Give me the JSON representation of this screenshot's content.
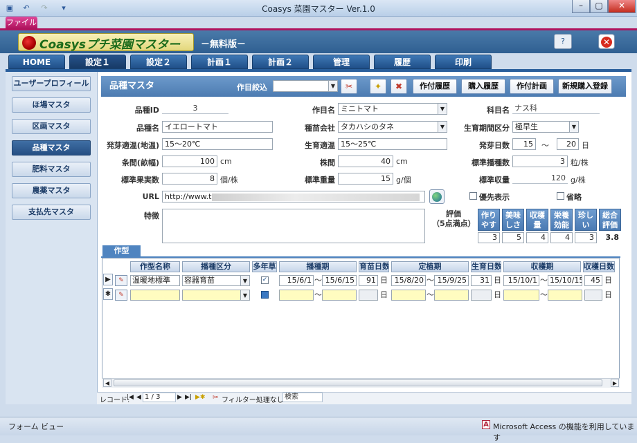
{
  "window": {
    "title": "Coasys 菜園マスター Ver.1.0",
    "file_tab": "ファイル"
  },
  "app": {
    "logo": "Coasysプチ菜園マスター",
    "edition": "－無料版－"
  },
  "nav_tabs": [
    "HOME",
    "設定１",
    "設定２",
    "計画１",
    "計画２",
    "管理",
    "履歴",
    "印刷"
  ],
  "sidebar": [
    "ユーザープロフィール",
    "ほ場マスタ",
    "区画マスタ",
    "品種マスタ",
    "肥料マスタ",
    "農薬マスタ",
    "支払先マスタ"
  ],
  "form": {
    "title": "品種マスタ",
    "filter_label": "作目絞込",
    "buttons": [
      "作付履歴",
      "購入履歴",
      "作付計画",
      "新規購入登録"
    ]
  },
  "fields": {
    "hinshu_id": {
      "label": "品種ID",
      "value": "3"
    },
    "sakumoku": {
      "label": "作目名",
      "value": "ミニトマト"
    },
    "kamoku": {
      "label": "科目名",
      "value": "ナス科"
    },
    "hinshu_name": {
      "label": "品種名",
      "value": "イエロートマト"
    },
    "company": {
      "label": "種苗会社",
      "value": "タカハシのタネ"
    },
    "period": {
      "label": "生育期間区分",
      "value": "極早生"
    },
    "hatsuga_temp": {
      "label": "発芽適温(地温)",
      "value": "15～20℃"
    },
    "seiiku_temp": {
      "label": "生育適温",
      "value": "15～25℃"
    },
    "hatsuga_days": {
      "label": "発芽日数",
      "from": "15",
      "tilde": "～",
      "to": "20",
      "unit": "日"
    },
    "jokan": {
      "label": "条間(畝幅)",
      "value": "100",
      "unit": "cm"
    },
    "kabuma": {
      "label": "株間",
      "value": "40",
      "unit": "cm"
    },
    "hashu": {
      "label": "標準播種数",
      "value": "3",
      "unit": "粒/株"
    },
    "kajitsu": {
      "label": "標準果実数",
      "value": "8",
      "unit": "個/株"
    },
    "juryo": {
      "label": "標準重量",
      "value": "15",
      "unit": "g/個"
    },
    "shukaku": {
      "label": "標準収量",
      "value": "120",
      "unit": "g/株"
    },
    "url": {
      "label": "URL",
      "value": "http://www.t"
    },
    "priority": {
      "label": "優先表示"
    },
    "omit": {
      "label": "省略"
    },
    "tokucho": {
      "label": "特徴"
    }
  },
  "evaluation": {
    "label": "評価\n（5点満点）",
    "headers": [
      "作りやすさ",
      "美味しさ",
      "収穫量",
      "栄養効能",
      "珍しい",
      "総合評価"
    ],
    "values": [
      "3",
      "5",
      "4",
      "4",
      "3",
      "3.8"
    ]
  },
  "subform": {
    "tab": "作型",
    "columns": [
      "作型名称",
      "播種区分",
      "多年草",
      "播種期",
      "育苗日数",
      "定植期",
      "生育日数",
      "収穫期",
      "収穫日数"
    ],
    "rows": [
      {
        "name": "温暖地標準",
        "type": "容器育苗",
        "sow_from": "15/6/1",
        "sow_to": "15/6/15",
        "nursery": "91",
        "plant_from": "15/8/20",
        "plant_to": "15/9/25",
        "grow": "31",
        "harv_from": "15/10/1",
        "harv_to": "15/10/15",
        "harv_days": "45"
      }
    ],
    "day_unit": "日",
    "tilde": "～"
  },
  "recordbar": {
    "label": "レコード:",
    "position": "1 / 3",
    "filter": "フィルター処理なし",
    "search": "検索"
  },
  "status": {
    "left": "フォーム ビュー",
    "right": "Microsoft Access の機能を利用しています"
  }
}
